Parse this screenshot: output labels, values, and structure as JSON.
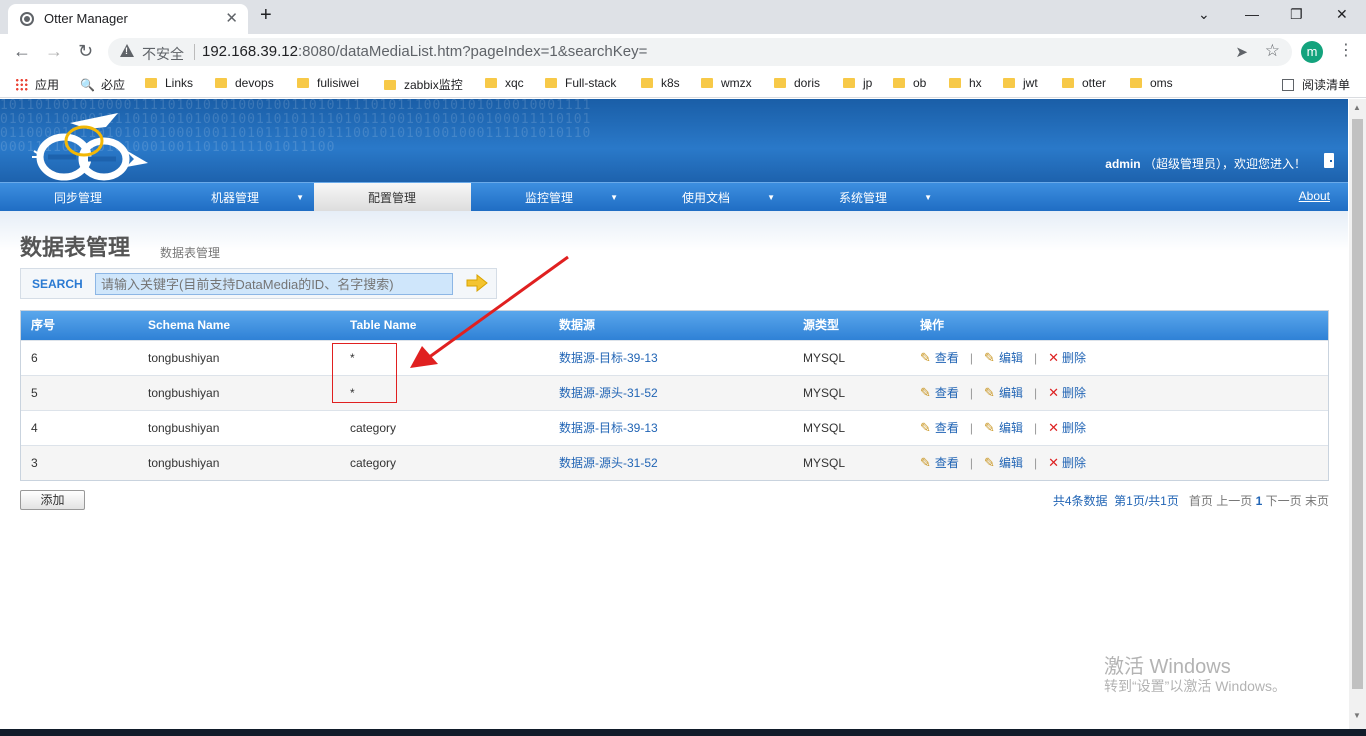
{
  "browser": {
    "tab_title": "Otter Manager",
    "insecure_label": "不安全",
    "url_host": "192.168.39.12",
    "url_rest": ":8080/dataMediaList.htm?pageIndex=1&searchKey=",
    "profile_initial": "m",
    "bookmarks": [
      "应用",
      "必应",
      "Links",
      "devops",
      "fulisiwei",
      "zabbix监控",
      "xqc",
      "Full-stack",
      "k8s",
      "wmzx",
      "doris",
      "jp",
      "ob",
      "hx",
      "jwt",
      "otter",
      "oms"
    ],
    "reading_list": "阅读清单"
  },
  "header": {
    "user": "admin",
    "role": "（超级管理员）",
    "welcome": "，欢迎您进入！",
    "binary_text": "10110100101000011110101010100010011010111101011100101010100100011110101011000011110101010100010011010111101011100101010100100011110101011000011110101010100010011010111101011100101010100100011110101011000011110101010100010011010111101011100"
  },
  "nav": {
    "items": [
      {
        "label": "同步管理",
        "arrow": ""
      },
      {
        "label": "机器管理",
        "arrow": "▼"
      },
      {
        "label": "配置管理",
        "arrow": ""
      },
      {
        "label": "监控管理",
        "arrow": "▼"
      },
      {
        "label": "使用文档",
        "arrow": "▼"
      },
      {
        "label": "系统管理",
        "arrow": "▼"
      }
    ],
    "about": "About",
    "active_index": 2
  },
  "page": {
    "title": "数据表管理",
    "subtitle": "数据表管理",
    "search_label": "SEARCH",
    "search_placeholder": "请输入关键字(目前支持DataMedia的ID、名字搜索)"
  },
  "table": {
    "columns": [
      "序号",
      "Schema Name",
      "Table Name",
      "数据源",
      "源类型",
      "操作"
    ],
    "rows": [
      {
        "id": "6",
        "schema": "tongbushiyan",
        "table": "*",
        "source": "数据源-目标-39-13",
        "type": "MYSQL"
      },
      {
        "id": "5",
        "schema": "tongbushiyan",
        "table": "*",
        "source": "数据源-源头-31-52",
        "type": "MYSQL"
      },
      {
        "id": "4",
        "schema": "tongbushiyan",
        "table": "category",
        "source": "数据源-目标-39-13",
        "type": "MYSQL"
      },
      {
        "id": "3",
        "schema": "tongbushiyan",
        "table": "category",
        "source": "数据源-源头-31-52",
        "type": "MYSQL"
      }
    ],
    "actions": {
      "view": "查看",
      "edit": "编辑",
      "delete": "删除"
    }
  },
  "footer": {
    "add_button": "添加",
    "total": "共4条数据",
    "page_info": "第1页/共1页",
    "first": "首页",
    "prev": "上一页",
    "current": "1",
    "next": "下一页",
    "last": "末页"
  },
  "watermark": {
    "line1": "激活 Windows",
    "line2": "转到“设置”以激活 Windows。"
  },
  "colors": {
    "header_blue": "#2a79c9",
    "nav_blue": "#1f6dc4",
    "link_blue": "#2265b5",
    "annotation_red": "#e02020"
  }
}
